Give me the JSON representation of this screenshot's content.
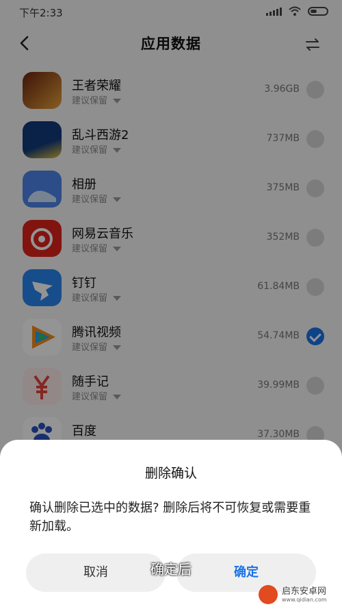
{
  "status_bar": {
    "time": "下午2:33"
  },
  "header": {
    "title": "应用数据"
  },
  "apps": [
    {
      "name": "王者荣耀",
      "sub": "建议保留",
      "size": "3.96GB",
      "checked": false,
      "colors": [
        "#6a2410",
        "#e9a23b"
      ]
    },
    {
      "name": "乱斗西游2",
      "sub": "建议保留",
      "size": "737MB",
      "checked": false,
      "colors": [
        "#123a7c",
        "#e0c13a"
      ]
    },
    {
      "name": "相册",
      "sub": "建议保留",
      "size": "375MB",
      "checked": false,
      "colors": [
        "#4d86e8",
        "#cfe2fb"
      ]
    },
    {
      "name": "网易云音乐",
      "sub": "建议保留",
      "size": "352MB",
      "checked": false,
      "colors": [
        "#e0241c",
        "#ffffff"
      ]
    },
    {
      "name": "钉钉",
      "sub": "建议保留",
      "size": "61.84MB",
      "checked": false,
      "colors": [
        "#2a86f0",
        "#ffffff"
      ]
    },
    {
      "name": "腾讯视频",
      "sub": "建议保留",
      "size": "54.74MB",
      "checked": true,
      "colors": [
        "#ffffff",
        "#f28d1d"
      ]
    },
    {
      "name": "随手记",
      "sub": "建议保留",
      "size": "39.99MB",
      "checked": false,
      "colors": [
        "#fbeaea",
        "#e6443a"
      ]
    },
    {
      "name": "百度",
      "sub": "",
      "size": "37.30MB",
      "checked": false,
      "colors": [
        "#ffffff",
        "#2a52be"
      ]
    }
  ],
  "dialog": {
    "title": "删除确认",
    "message": "确认删除已选中的数据? 删除后将不可恢复或需要重新加载。",
    "cancel_label": "取消",
    "confirm_label": "确定"
  },
  "overlay_caption": "确定后",
  "watermark": {
    "line1": "启东安卓网",
    "line2": "www.qidian.com"
  },
  "colors": {
    "accent": "#1a73e8"
  }
}
